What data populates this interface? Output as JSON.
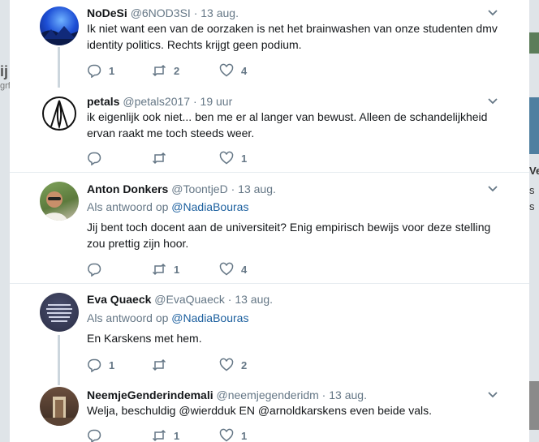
{
  "background": {
    "left_fragments": [
      "ij",
      "grf"
    ],
    "right_fragments": [
      "Ve",
      "s",
      "s"
    ]
  },
  "tweets": [
    {
      "name": "NoDeSi",
      "handle": "@6NOD3SI",
      "time": "13 aug.",
      "text": "Ik niet want een van de oorzaken is net het brainwashen van onze studenten dmv identity politics. Rechts krijgt geen podium.",
      "reply_to_label": "",
      "reply_to": "",
      "replies": "1",
      "retweets": "2",
      "likes": "4"
    },
    {
      "name": "petals",
      "handle": "@petals2017",
      "time": "19 uur",
      "text": "ik eigenlijk ook niet... ben me er al langer van bewust. Alleen de schandelijkheid ervan raakt me toch steeds weer.",
      "reply_to_label": "",
      "reply_to": "",
      "replies": "",
      "retweets": "",
      "likes": "1"
    },
    {
      "name": "Anton Donkers",
      "handle": "@ToontjeD",
      "time": "13 aug.",
      "reply_to_label": "Als antwoord op",
      "reply_to": "@NadiaBouras",
      "text": "Jij bent toch docent aan de universiteit? Enig empirisch bewijs voor deze stelling zou prettig zijn hoor.",
      "replies": "",
      "retweets": "1",
      "likes": "4"
    },
    {
      "name": "Eva Quaeck",
      "handle": "@EvaQuaeck",
      "time": "13 aug.",
      "reply_to_label": "Als antwoord op",
      "reply_to": "@NadiaBouras",
      "text": "En Karskens met hem.",
      "replies": "1",
      "retweets": "",
      "likes": "2"
    },
    {
      "name": "NeemjeGenderindemali",
      "handle": "@neemjegenderidm",
      "time": "13 aug.",
      "reply_to_label": "",
      "reply_to": "",
      "text": "Welja, beschuldig @wierdduk EN @arnoldkarskens even beide vals.",
      "replies": "",
      "retweets": "1",
      "likes": "1"
    }
  ],
  "separator": " · ",
  "icons": {
    "reply": "reply-icon",
    "retweet": "retweet-icon",
    "like": "heart-icon",
    "more": "chevron-down-icon"
  },
  "colors": {
    "text": "#14171a",
    "secondary": "#657786",
    "mention": "#1b5f9e",
    "thread_line": "#ccd6dd"
  }
}
